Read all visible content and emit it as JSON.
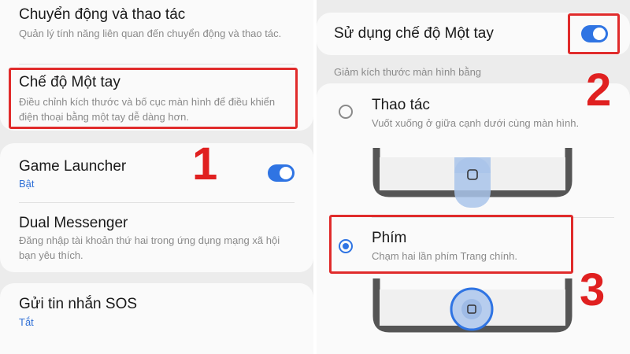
{
  "left": {
    "motion": {
      "title": "Chuyển động và thao tác",
      "desc": "Quản lý tính năng liên quan đến chuyển động và thao tác."
    },
    "one_hand": {
      "title": "Chế độ Một tay",
      "desc": "Điều chỉnh kích thước và bố cục màn hình để điều khiển điện thoại bằng một tay dễ dàng hơn."
    },
    "game_launcher": {
      "title": "Game Launcher",
      "status": "Bật",
      "enabled": true
    },
    "dual_messenger": {
      "title": "Dual Messenger",
      "desc": "Đăng nhập tài khoản thứ hai trong ứng dụng mạng xã hội bạn yêu thích."
    },
    "sos": {
      "title": "Gửi tin nhắn SOS",
      "status": "Tắt"
    },
    "step_label": "1"
  },
  "right": {
    "use_one_hand": {
      "title": "Sử dụng chế độ Một tay",
      "enabled": true
    },
    "section_label": "Giảm kích thước màn hình bằng",
    "options": [
      {
        "title": "Thao tác",
        "desc": "Vuốt xuống ở giữa cạnh dưới cùng màn hình.",
        "selected": false
      },
      {
        "title": "Phím",
        "desc": "Chạm hai lần phím Trang chính.",
        "selected": true
      }
    ],
    "step_label_2": "2",
    "step_label_3": "3"
  },
  "colors": {
    "accent": "#2f74e3",
    "highlight": "#e02b2b",
    "background": "#ececec",
    "card": "#fafafa"
  }
}
